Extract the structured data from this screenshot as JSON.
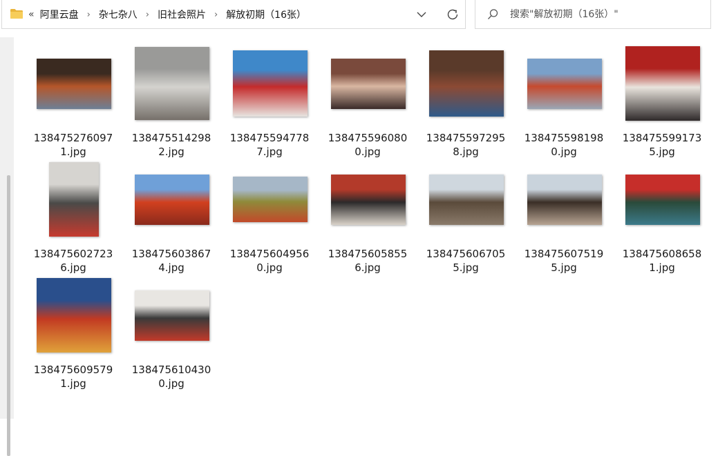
{
  "breadcrumb": {
    "overflow": "«",
    "items": [
      "阿里云盘",
      "杂七杂八",
      "旧社会照片",
      "解放初期（16张）"
    ],
    "separator": "›"
  },
  "search": {
    "placeholder": "搜索\"解放初期（16张）\""
  },
  "icons": {
    "folder": "folder-icon",
    "dropdown": "chevron-down-icon",
    "refresh": "refresh-icon",
    "search": "search-icon"
  },
  "colors": {
    "folder": "#f4c44e",
    "selection_strip": "#c2c2c2"
  },
  "files": [
    {
      "line1": "138475276097",
      "line2": "1.jpg",
      "shape": "wide",
      "colors": [
        "#3a2a20",
        "#b5562a",
        "#6d7f95"
      ]
    },
    {
      "line1": "138475514298",
      "line2": "2.jpg",
      "shape": "wide2",
      "colors": [
        "#9a9a98",
        "#d4d3cf",
        "#76706a"
      ]
    },
    {
      "line1": "138475594778",
      "line2": "7.jpg",
      "shape": "tall",
      "colors": [
        "#3f88c9",
        "#c42b2b",
        "#e7e4e0"
      ]
    },
    {
      "line1": "138475596080",
      "line2": "0.jpg",
      "shape": "wide",
      "colors": [
        "#7a4a3c",
        "#d9b7a2",
        "#3a2a28"
      ]
    },
    {
      "line1": "138475597295",
      "line2": "8.jpg",
      "shape": "tall",
      "colors": [
        "#5a3a2a",
        "#8c4a34",
        "#2e5a8a"
      ]
    },
    {
      "line1": "138475598198",
      "line2": "0.jpg",
      "shape": "wide",
      "colors": [
        "#7aa0c9",
        "#c64a2e",
        "#9aa6b5"
      ]
    },
    {
      "line1": "138475599173",
      "line2": "5.jpg",
      "shape": "square",
      "colors": [
        "#b0221f",
        "#e9e4dd",
        "#2f2a2a"
      ]
    },
    {
      "line1": "138475602723",
      "line2": "6.jpg",
      "shape": "portrait",
      "colors": [
        "#d6d4d0",
        "#4a4a48",
        "#c63a2e"
      ]
    },
    {
      "line1": "138475603867",
      "line2": "4.jpg",
      "shape": "wide",
      "colors": [
        "#6fa0d8",
        "#d1401f",
        "#8a2a1c"
      ]
    },
    {
      "line1": "138475604956",
      "line2": "0.jpg",
      "shape": "wide3",
      "colors": [
        "#a6b7c7",
        "#8f8a3a",
        "#c24a2a"
      ]
    },
    {
      "line1": "138475605855",
      "line2": "6.jpg",
      "shape": "wide",
      "colors": [
        "#b33a2a",
        "#2c2a2a",
        "#d9d2c9"
      ]
    },
    {
      "line1": "138475606705",
      "line2": "5.jpg",
      "shape": "wide",
      "colors": [
        "#cfd7de",
        "#5a4a3a",
        "#8a7a6a"
      ]
    },
    {
      "line1": "138475607519",
      "line2": "5.jpg",
      "shape": "wide",
      "colors": [
        "#c9d3dc",
        "#3a2e26",
        "#b7a493"
      ]
    },
    {
      "line1": "138475608658",
      "line2": "1.jpg",
      "shape": "wide",
      "colors": [
        "#c62e2a",
        "#2a4a3a",
        "#3c7a8a"
      ]
    },
    {
      "line1": "138475609579",
      "line2": "1.jpg",
      "shape": "square",
      "colors": [
        "#2a4f8c",
        "#c23a22",
        "#e0a23a"
      ]
    },
    {
      "line1": "138475610430",
      "line2": "0.jpg",
      "shape": "wide",
      "colors": [
        "#e8e6e2",
        "#3a3a3a",
        "#c23a2a"
      ]
    }
  ]
}
